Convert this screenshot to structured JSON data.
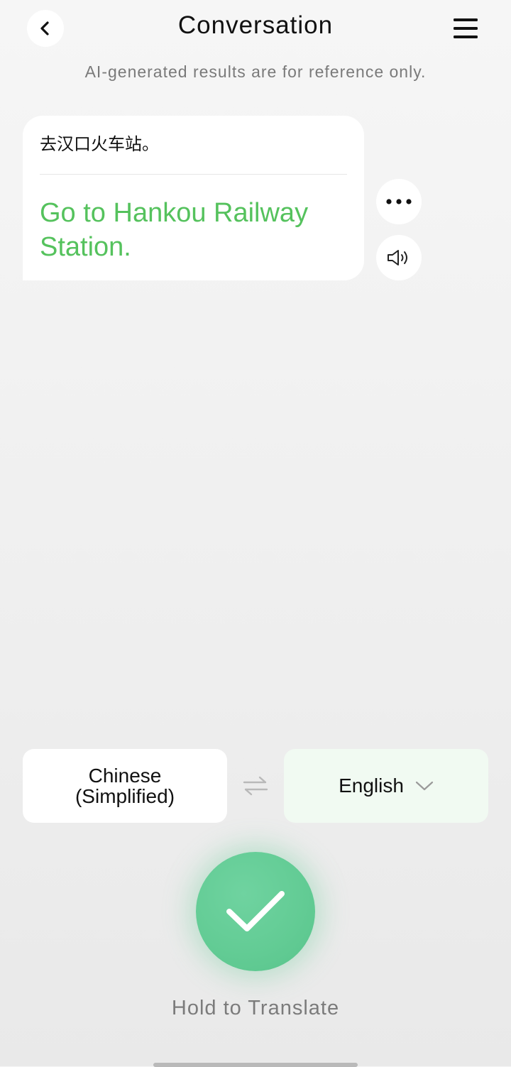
{
  "header": {
    "title": "Conversation",
    "back_icon": "chevron-left-icon",
    "menu_icon": "hamburger-menu-icon"
  },
  "disclaimer": "AI-generated results are for reference only.",
  "message": {
    "source_text": "去汉口火车站。",
    "translated_text": "Go to Hankou Railway Station.",
    "more_icon": "more-dots-icon",
    "speaker_icon": "speaker-icon"
  },
  "languages": {
    "source": "Chinese (Simplified)",
    "target": "English",
    "swap_icon": "swap-arrows-icon",
    "dropdown_icon": "chevron-down-icon"
  },
  "record": {
    "icon": "checkmark-icon",
    "hint": "Hold to Translate"
  },
  "colors": {
    "accent_green": "#55c25d",
    "record_green": "#63cc95",
    "target_bg": "#f1faf2"
  }
}
